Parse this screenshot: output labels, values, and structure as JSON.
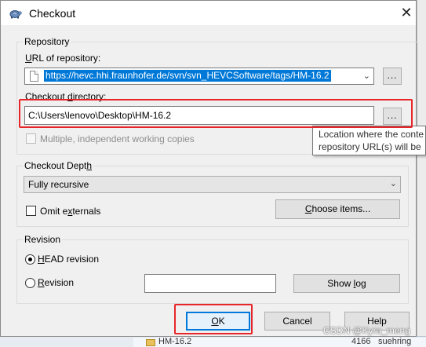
{
  "window": {
    "title": "Checkout",
    "close_glyph": "✕"
  },
  "repository": {
    "group_label": "Repository",
    "url_label": "URL of repository:",
    "url_value": "https://hevc.hhi.fraunhofer.de/svn/svn_HEVCSoftware/tags/HM-16.2",
    "url_browse_label": "...",
    "dir_label": "Checkout directory:",
    "dir_value": "C:\\Users\\lenovo\\Desktop\\HM-16.2",
    "dir_browse_label": "...",
    "multiple_label": "Multiple, independent working copies",
    "multiple_checked": false
  },
  "tooltip": {
    "line1": "Location where the conte",
    "line2": "repository URL(s) will be"
  },
  "depth": {
    "group_label": "Checkout Depth",
    "selected": "Fully recursive",
    "omit_externals_label": "Omit externals",
    "omit_externals_checked": false,
    "choose_items_label": "Choose items..."
  },
  "revision": {
    "group_label": "Revision",
    "head_label": "HEAD revision",
    "revision_label": "Revision",
    "selected": "HEAD revision",
    "revision_value": "",
    "show_log_label": "Show log"
  },
  "footer": {
    "ok_label": "OK",
    "cancel_label": "Cancel",
    "help_label": "Help"
  },
  "background": {
    "bottom_row_name": "HM-16.2",
    "bottom_row_rev": "4166",
    "bottom_row_author": "suehring"
  },
  "watermark": "CSDN @Kyra_meng",
  "colors": {
    "highlight": "#e8262a",
    "selection": "#0078d7",
    "dialog_bg": "#f0f0f0"
  }
}
